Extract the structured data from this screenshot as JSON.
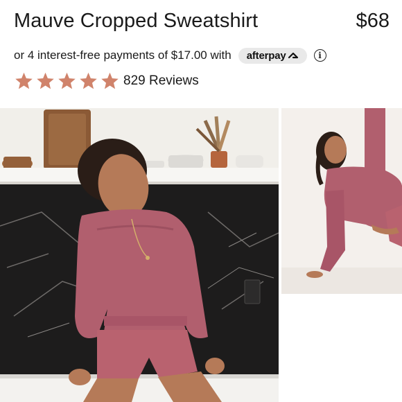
{
  "product": {
    "title": "Mauve Cropped Sweatshirt",
    "price": "$68"
  },
  "payment": {
    "text": "or 4 interest-free payments of $17.00 with",
    "provider_label": "afterpay",
    "info_symbol": "i"
  },
  "rating": {
    "stars": 5,
    "max_stars": 5,
    "reviews_label": "829 Reviews",
    "star_color": "#d0836b"
  },
  "images": [
    {
      "name": "main-product-photo",
      "garment_color": "#b15f6e"
    },
    {
      "name": "side-product-photo",
      "garment_color": "#b15f6e"
    }
  ]
}
